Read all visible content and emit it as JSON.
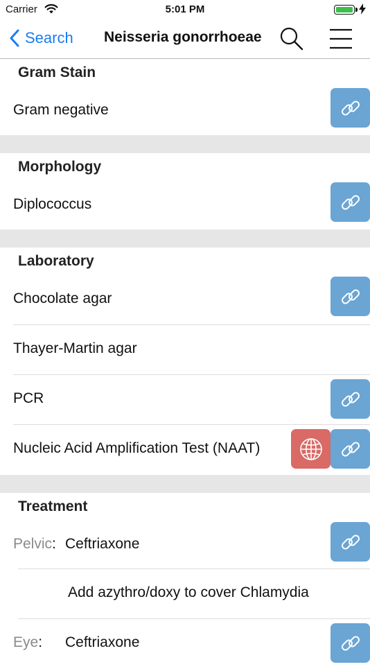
{
  "status_bar": {
    "carrier": "Carrier",
    "time": "5:01 PM"
  },
  "nav": {
    "back_label": "Search",
    "title": "Neisseria gonorrhoeae"
  },
  "colors": {
    "accent": "#1a7cf5",
    "link_button": "#6aa5d4",
    "globe_button": "#d96a66",
    "separator_band": "#e6e6e6"
  },
  "sections": {
    "gram_stain": {
      "title": "Gram Stain",
      "items": [
        "Gram negative"
      ]
    },
    "morphology": {
      "title": "Morphology",
      "items": [
        "Diplococcus"
      ]
    },
    "laboratory": {
      "title": "Laboratory",
      "items": [
        "Chocolate agar",
        "Thayer-Martin agar",
        "PCR",
        "Nucleic Acid Amplification Test (NAAT)"
      ]
    },
    "treatment": {
      "title": "Treatment",
      "rows": [
        {
          "prefix": "Pelvic",
          "sep": ":",
          "value": "Ceftriaxone"
        },
        {
          "note": "Add azythro/doxy to cover Chlamydia"
        },
        {
          "prefix": "Eye",
          "sep": ":",
          "value": "Ceftriaxone"
        }
      ]
    }
  },
  "icons": {
    "link": "link-icon",
    "globe": "globe-icon",
    "search": "search-icon",
    "menu": "hamburger-menu-icon",
    "back": "chevron-left-icon"
  }
}
